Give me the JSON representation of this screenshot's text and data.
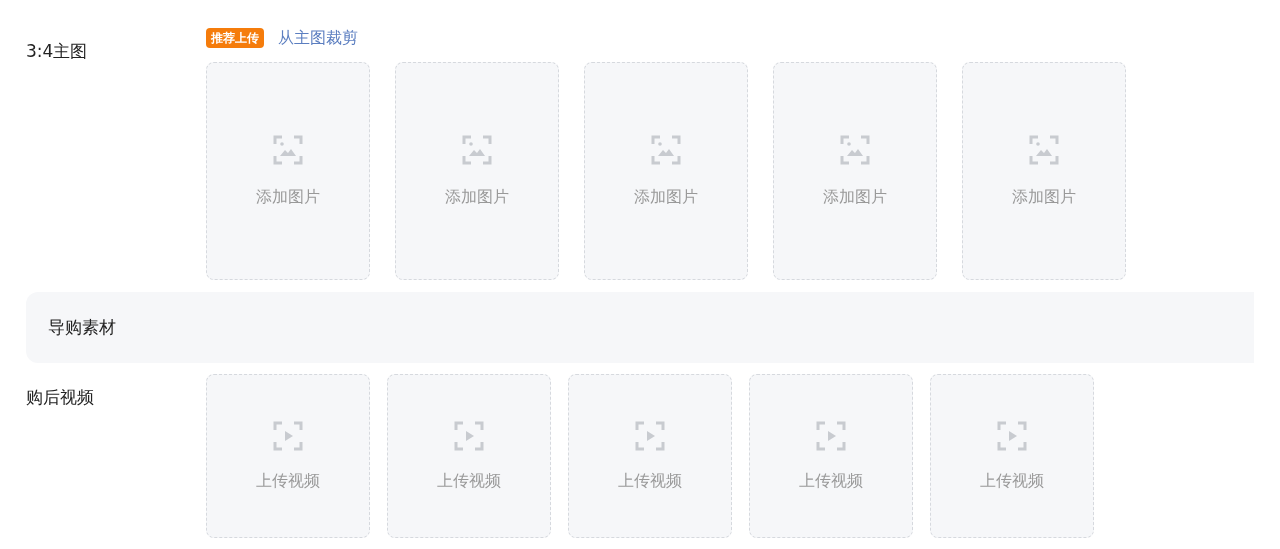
{
  "main_image_row": {
    "label": "3:4主图",
    "badge": "推荐上传",
    "link": "从主图裁剪",
    "slots": [
      {
        "kind": "image",
        "label": "添加图片"
      },
      {
        "kind": "image",
        "label": "添加图片"
      },
      {
        "kind": "image",
        "label": "添加图片"
      },
      {
        "kind": "image",
        "label": "添加图片"
      },
      {
        "kind": "image",
        "label": "添加图片"
      }
    ]
  },
  "section": {
    "title": "导购素材"
  },
  "video_row": {
    "label": "购后视频",
    "slots": [
      {
        "kind": "video",
        "label": "上传视频"
      },
      {
        "kind": "video",
        "label": "上传视频"
      },
      {
        "kind": "video",
        "label": "上传视频"
      },
      {
        "kind": "video",
        "label": "上传视频"
      },
      {
        "kind": "video",
        "label": "上传视频"
      }
    ]
  }
}
